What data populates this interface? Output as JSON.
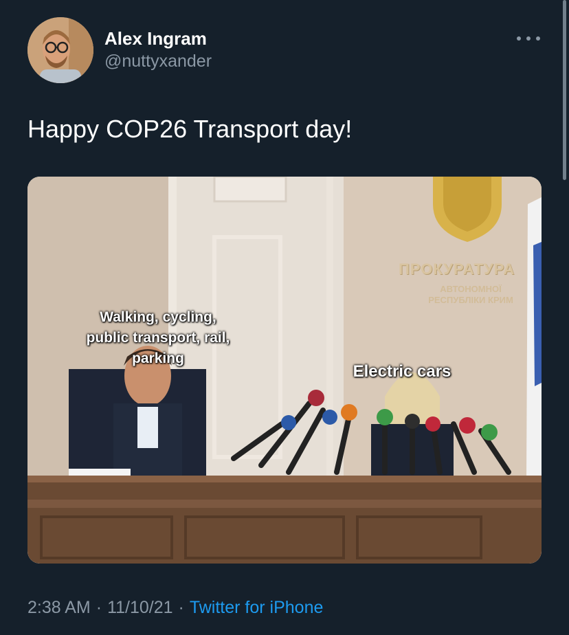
{
  "tweet": {
    "author": {
      "display_name": "Alex Ingram",
      "handle": "@nuttyxander"
    },
    "text": "Happy COP26 Transport day!",
    "media": {
      "caption_left": "Walking, cycling, public transport, rail, parking",
      "caption_right": "Electric cars",
      "sign_main": "ПРОКУРАТУРА",
      "sign_sub": "АВТОНОМНОЇ РЕСПУБЛІКИ КРИМ"
    },
    "time": "2:38 AM",
    "date": "11/10/21",
    "separator": "·",
    "source": "Twitter for iPhone"
  },
  "icons": {
    "more": "more-horizontal-icon"
  },
  "colors": {
    "background": "#15202b",
    "secondary_text": "#8b98a5",
    "link": "#1d9bf0"
  }
}
